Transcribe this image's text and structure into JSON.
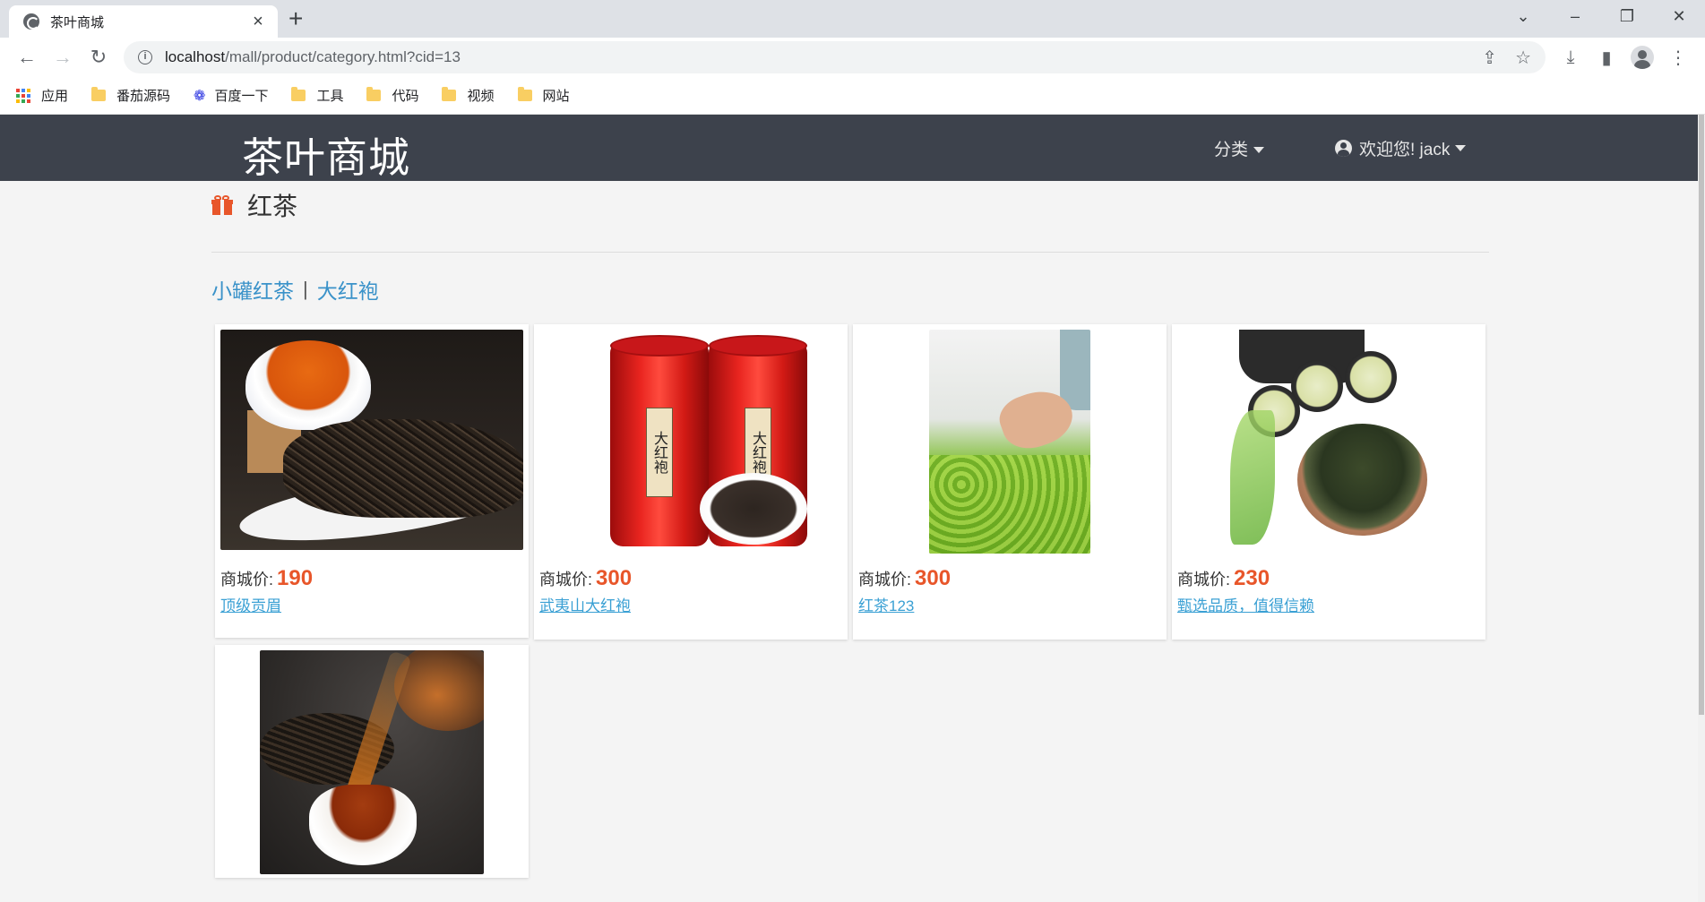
{
  "browser": {
    "tab_title": "茶叶商城",
    "url_host": "localhost",
    "url_path": "/mall/product/category.html?cid=13",
    "bookmarks": [
      {
        "label": "应用",
        "icon": "apps-grid-icon"
      },
      {
        "label": "番茄源码",
        "icon": "folder-icon"
      },
      {
        "label": "百度一下",
        "icon": "baidu-paw-icon"
      },
      {
        "label": "工具",
        "icon": "folder-icon"
      },
      {
        "label": "代码",
        "icon": "folder-icon"
      },
      {
        "label": "视频",
        "icon": "folder-icon"
      },
      {
        "label": "网站",
        "icon": "folder-icon"
      }
    ]
  },
  "site": {
    "brand": "茶叶商城",
    "nav_category": "分类",
    "nav_user": "欢迎您! jack"
  },
  "category": {
    "title": "红茶",
    "subcategories": [
      "小罐红茶",
      "大红袍"
    ],
    "separator": "|"
  },
  "products": [
    {
      "price_label": "商城价:",
      "price": "190",
      "name": "顶级贡眉",
      "image": "tea-leaves-with-cup"
    },
    {
      "price_label": "商城价:",
      "price": "300",
      "name": "武夷山大红袍",
      "image": "red-tea-cans",
      "can_label": "大红袍"
    },
    {
      "price_label": "商城价:",
      "price": "300",
      "name": "红茶123",
      "image": "hand-picking-tea"
    },
    {
      "price_label": "商城价:",
      "price": "230",
      "name": "甄选品质，值得信赖",
      "image": "green-tea-bowl"
    },
    {
      "image": "pouring-tea"
    }
  ],
  "colors": {
    "nav_bg": "#3d424c",
    "price": "#e8562a",
    "link": "#3a92c9",
    "page_bg": "#f4f4f4"
  }
}
